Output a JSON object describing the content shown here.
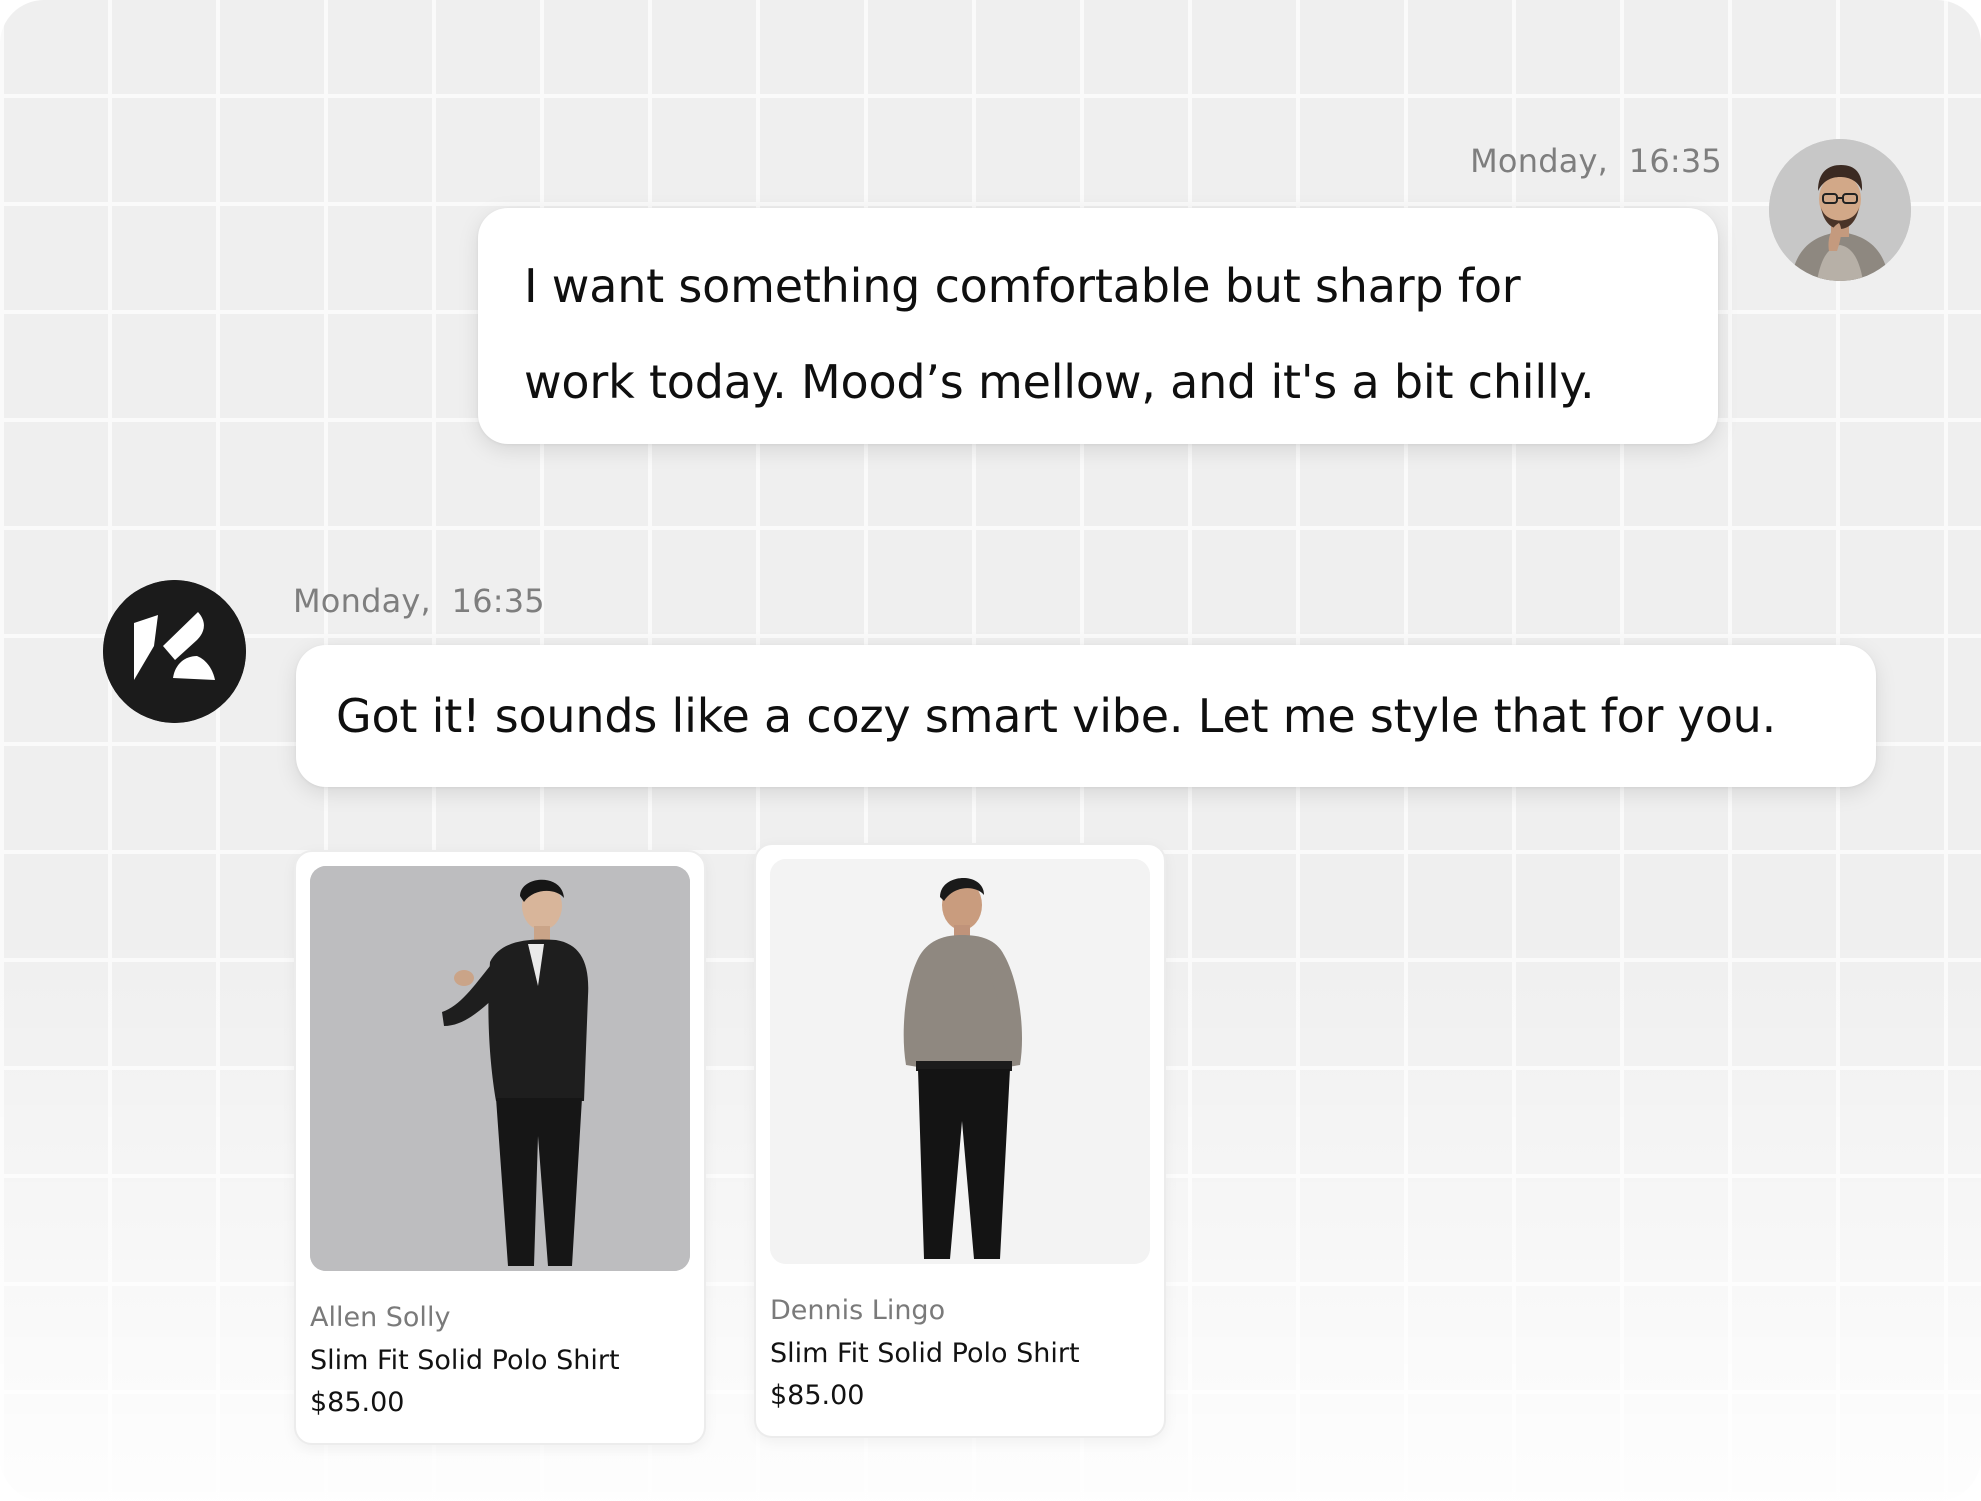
{
  "conversation": {
    "user_message": {
      "timestamp": "Monday,  16:35",
      "text_line1": "I want something comfortable but sharp for",
      "text_line2": "work today. Mood’s mellow, and it's a bit chilly."
    },
    "bot_message": {
      "timestamp": "Monday,  16:35",
      "text": "Got it! sounds like a cozy smart vibe. Let me style that for you."
    }
  },
  "products": [
    {
      "brand": "Allen Solly",
      "name": "Slim Fit Solid Polo Shirt",
      "price": "$85.00"
    },
    {
      "brand": "Dennis Lingo",
      "name": "Slim Fit Solid Polo Shirt",
      "price": "$85.00"
    }
  ],
  "icons": {
    "user_avatar": "user-avatar-photo",
    "bot_avatar": "brand-logo-icon"
  },
  "colors": {
    "background": "#efefef",
    "grid_lines": "#fafafa",
    "bubble": "#ffffff",
    "timestamp": "#7e7e7e",
    "bot_logo": "#1b1b1b",
    "brand_text": "#7a7a7a"
  }
}
